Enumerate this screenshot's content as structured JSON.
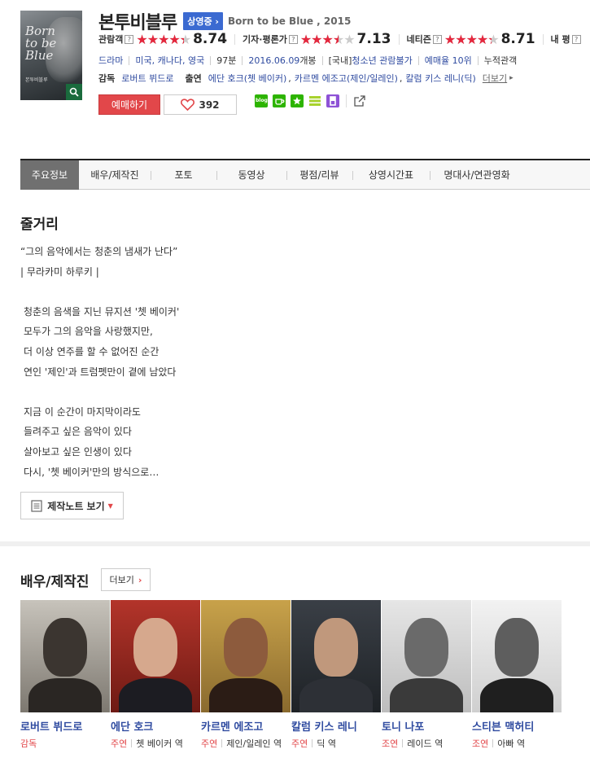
{
  "movie": {
    "title_ko": "본투비블루",
    "status": "상영중",
    "title_en": "Born to be Blue , 2015",
    "poster": {
      "title": "Born\nto be\nBlue",
      "subtitle": "본투비블루"
    }
  },
  "scores": [
    {
      "label": "관람객",
      "rating": 8.74,
      "value": "8.74"
    },
    {
      "label": "기자·평론가",
      "rating": 7.13,
      "value": "7.13"
    },
    {
      "label": "네티즌",
      "rating": 8.71,
      "value": "8.71"
    },
    {
      "label": "내 평",
      "rating": 0,
      "value": ""
    }
  ],
  "info": {
    "genre": "드라마",
    "country": "미국, 캐나다, 영국",
    "runtime": "97분",
    "release_date": "2016.06.09",
    "release_suffix": " 개봉",
    "rating_prefix": "[국내] ",
    "rating": "청소년 관람불가",
    "booking": "예매율 10위",
    "cumulative": "누적관객"
  },
  "crew": {
    "director_label": "감독",
    "director": "로버트 뷔드로",
    "cast_label": "출연",
    "cast": [
      "에단 호크(쳇 베이커)",
      "카르멘 에조고(제인/일레인)",
      "칼럼 키스 레니(딕)"
    ],
    "more": "더보기"
  },
  "actions": {
    "book": "예매하기",
    "likes": "392"
  },
  "tabs": [
    "주요정보",
    "배우/제작진",
    "포토",
    "동영상",
    "평점/리뷰",
    "상영시간표",
    "명대사/연관영화"
  ],
  "synopsis": {
    "heading": "줄거리",
    "lines": [
      "“그의 음악에서는 청춘의 냄새가 난다”",
      "| 무라카미 하루키 |",
      "",
      "청춘의 음색을 지닌 뮤지션 '쳇 베이커'",
      "모두가 그의 음악을 사랑했지만,",
      "더 이상 연주를 할 수 없어진 순간",
      "연인 '제인'과 트럼펫만이 곁에 남았다",
      "",
      "지금 이 순간이 마지막이라도",
      "들려주고 싶은 음악이 있다",
      "살아보고 싶은 인생이 있다",
      "다시, '쳇 베이커'만의 방식으로…"
    ],
    "notes_button": "제작노트 보기"
  },
  "cast_section": {
    "heading": "배우/제작진",
    "more": "더보기",
    "people": [
      {
        "name": "로버트 뷔드로",
        "kind": "감독",
        "role": ""
      },
      {
        "name": "에단 호크",
        "kind": "주연",
        "role": "쳇 베이커 역"
      },
      {
        "name": "카르멘 에조고",
        "kind": "주연",
        "role": "제인/일레인 역"
      },
      {
        "name": "칼럼 키스 레니",
        "kind": "주연",
        "role": "딕 역"
      },
      {
        "name": "토니 나포",
        "kind": "조연",
        "role": "레이드 역"
      },
      {
        "name": "스티븐 맥허티",
        "kind": "조연",
        "role": "아빠 역"
      }
    ]
  },
  "colors": {
    "accent_red": "#e2474a",
    "link_blue": "#2f4ba0",
    "badge_blue": "#3b6ad1"
  }
}
